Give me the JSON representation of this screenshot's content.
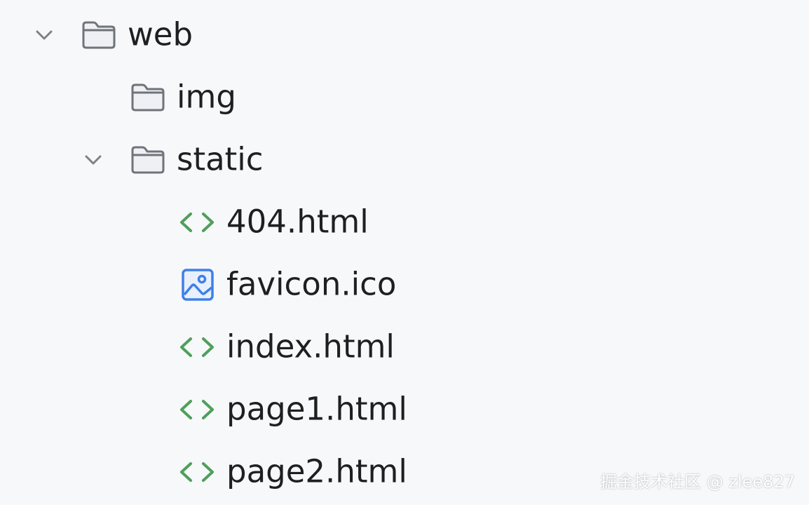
{
  "colors": {
    "background": "#f7f8fa",
    "text": "#1f1f1f",
    "chevron": "#7f8187",
    "folder_stroke": "#6f737a",
    "html_icon": "#4f9f5b",
    "image_icon": "#3f7fe8"
  },
  "tree": {
    "items": [
      {
        "label": "web",
        "icon": "folder-icon",
        "expanded": true
      },
      {
        "label": "img",
        "icon": "folder-icon",
        "expanded": false
      },
      {
        "label": "static",
        "icon": "folder-icon",
        "expanded": true
      },
      {
        "label": "404.html",
        "icon": "html-file-icon"
      },
      {
        "label": "favicon.ico",
        "icon": "image-file-icon"
      },
      {
        "label": "index.html",
        "icon": "html-file-icon"
      },
      {
        "label": "page1.html",
        "icon": "html-file-icon"
      },
      {
        "label": "page2.html",
        "icon": "html-file-icon"
      }
    ]
  },
  "watermark": {
    "text": "掘金技术社区 @ zlee827"
  }
}
